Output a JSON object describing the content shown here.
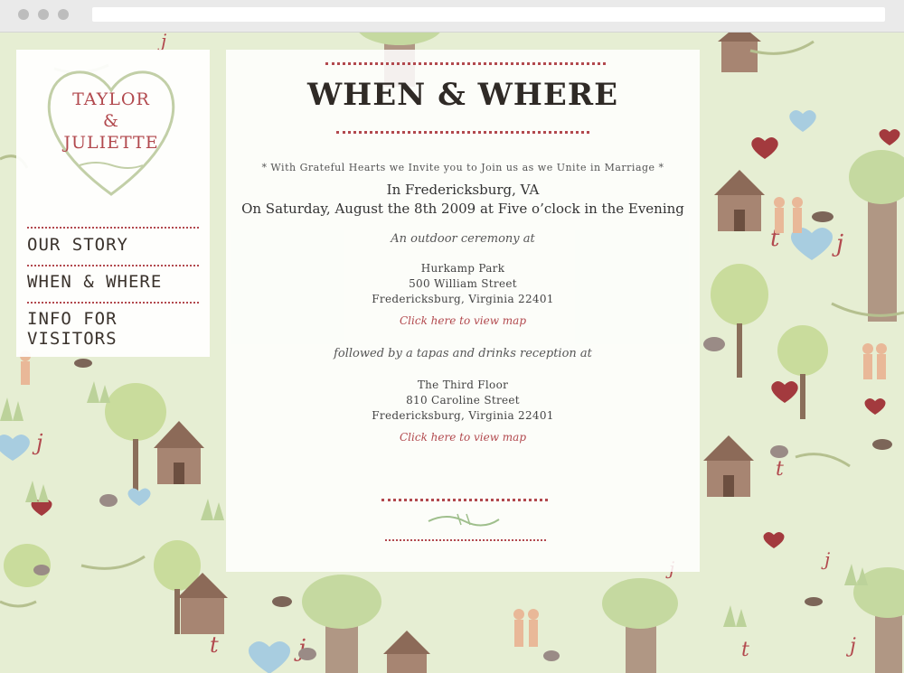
{
  "sidebar": {
    "logo": {
      "line1": "TAYLOR",
      "amp": "&",
      "line2": "JULIETTE"
    },
    "nav": [
      {
        "label": "OUR STORY"
      },
      {
        "label": "WHEN & WHERE"
      },
      {
        "label": "INFO FOR VISITORS"
      }
    ]
  },
  "main": {
    "title": "WHEN & WHERE",
    "invite_line": "* With Grateful Hearts we Invite you to Join us as we Unite in Marriage *",
    "location": "In Fredericksburg, VA",
    "date_line": "On Saturday, August the 8th 2009 at Five o’clock in the Evening",
    "ceremony": {
      "intro": "An outdoor ceremony at",
      "address": [
        "Hurkamp Park",
        "500 William Street",
        "Fredericksburg, Virginia 22401"
      ],
      "map_link": "Click here to view map"
    },
    "reception": {
      "intro": "followed by a tapas and drinks reception at",
      "address": [
        "The Third Floor",
        "810 Caroline Street",
        "Fredericksburg, Virginia 22401"
      ],
      "map_link": "Click here to view map"
    }
  },
  "colors": {
    "accent": "#b2494e",
    "background": "#e6eed3",
    "text": "#3b3b3b"
  }
}
